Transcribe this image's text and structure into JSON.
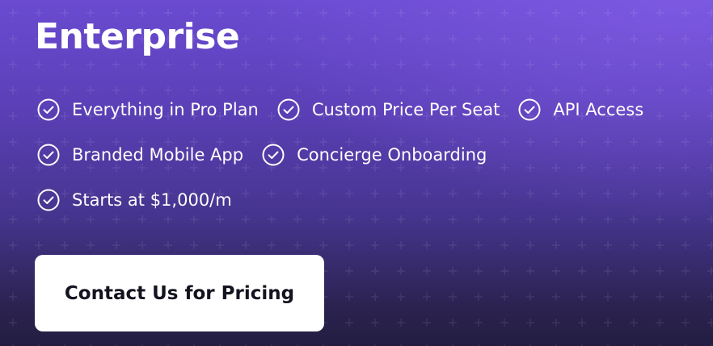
{
  "card": {
    "title": "Enterprise",
    "feature_rows": [
      [
        "Everything in Pro Plan",
        "Custom Price Per Seat",
        "API Access"
      ],
      [
        "Branded Mobile App",
        "Concierge Onboarding"
      ],
      [
        "Starts at $1,000/m"
      ]
    ],
    "feature_icon": "check-circle-icon",
    "cta_label": "Contact Us for Pricing"
  },
  "colors": {
    "background_top": "#6a4bd1",
    "background_bottom": "#231d40",
    "text": "#ffffff",
    "button_bg": "#ffffff",
    "button_text": "#141320"
  }
}
